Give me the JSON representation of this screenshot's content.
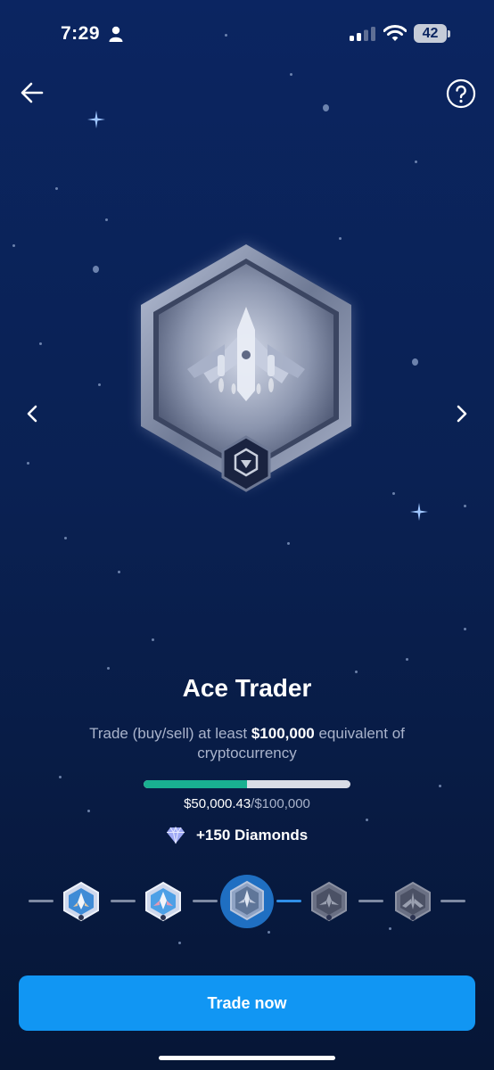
{
  "status_bar": {
    "time": "7:29",
    "battery": "42"
  },
  "badge": {
    "name": "Ace Trader"
  },
  "description": {
    "prefix": "Trade (buy/sell) at least ",
    "amount": "$100,000",
    "suffix": " equivalent of cryptocurrency"
  },
  "progress": {
    "current": "$50,000.43",
    "target": "/$100,000",
    "fraction": 0.5
  },
  "reward": {
    "label": "+150 Diamonds"
  },
  "cta": {
    "label": "Trade now"
  },
  "icons": [
    "back-arrow-icon",
    "help-icon",
    "chevron-left-icon",
    "chevron-right-icon",
    "diamond-icon",
    "person-icon",
    "wifi-icon",
    "signal-icon"
  ],
  "colors": {
    "accent": "#1196f3",
    "progress": "#19b091",
    "background": "#0b2561"
  }
}
